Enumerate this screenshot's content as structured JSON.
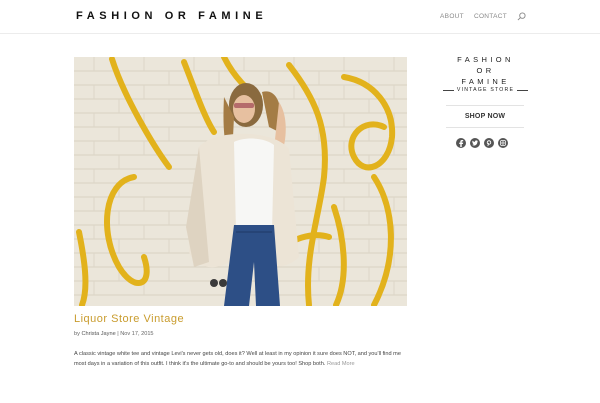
{
  "site": {
    "title": "FASHION OR FAMINE"
  },
  "nav": {
    "items": [
      "ABOUT",
      "CONTACT"
    ],
    "search_icon": "search-icon"
  },
  "post": {
    "image_alt": "woman in white fur coat and jeans against graffiti brick wall",
    "title": "Liquor Store Vintage",
    "meta_prefix": "by",
    "author": "Christa Jayne",
    "date": "Nov 17, 2015",
    "excerpt": "A classic vintage white tee and vintage Levi's never gets old, does it? Well at least in my opinion it sure does NOT, and you'll find me most days in a variation of this outfit. I think it's the ultimate go-to and should be yours too! Shop both.",
    "read_more": "Read More"
  },
  "sidebar": {
    "logo_lines": [
      "FASHION",
      "OR",
      "FAMINE"
    ],
    "logo_sub": "VINTAGE STORE",
    "shop_now": "SHOP NOW",
    "social_icons": [
      "facebook-icon",
      "twitter-icon",
      "pinterest-icon",
      "instagram-icon"
    ]
  },
  "colors": {
    "accent": "#c99c2e",
    "social": "#555555"
  }
}
